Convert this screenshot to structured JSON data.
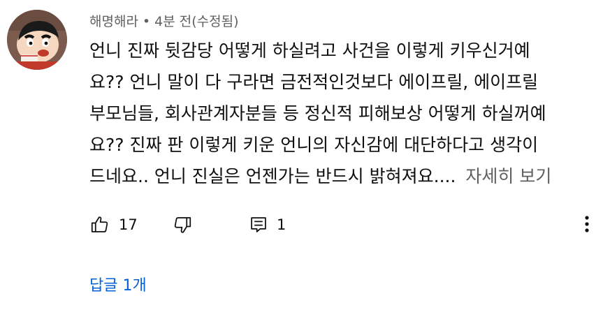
{
  "comment": {
    "author": "해명해라",
    "separator": "•",
    "time": "4분 전(수정됨)",
    "text_lines": [
      "언니 진짜 뒷감당 어떻게 하실려고 사건을 이렇게 키우신거예",
      "요?? 언니 말이 다 구라면 금전적인것보다 에이프릴, 에이프릴",
      "부모님들, 회사관계자분들 등 정신적 피해보상 어떻게 하실꺼예",
      "요?? 진짜 판 이렇게 키운 언니의 자신감에 대단하다고 생각이",
      "드네요.. 언니 진실은 언젠가는 반드시 밝혀져요...."
    ],
    "read_more": "자세히 보기",
    "like_count": "17",
    "reply_count": "1",
    "view_replies": "답글 1개"
  },
  "icons": {
    "avatar": "cartoon-avatar",
    "like": "thumbs-up-icon",
    "dislike": "thumbs-down-icon",
    "reply": "comment-reply-icon",
    "menu": "more-vertical-icon"
  },
  "colors": {
    "meta_text": "#606060",
    "body_text": "#0f0f0f",
    "link": "#065fd4"
  }
}
